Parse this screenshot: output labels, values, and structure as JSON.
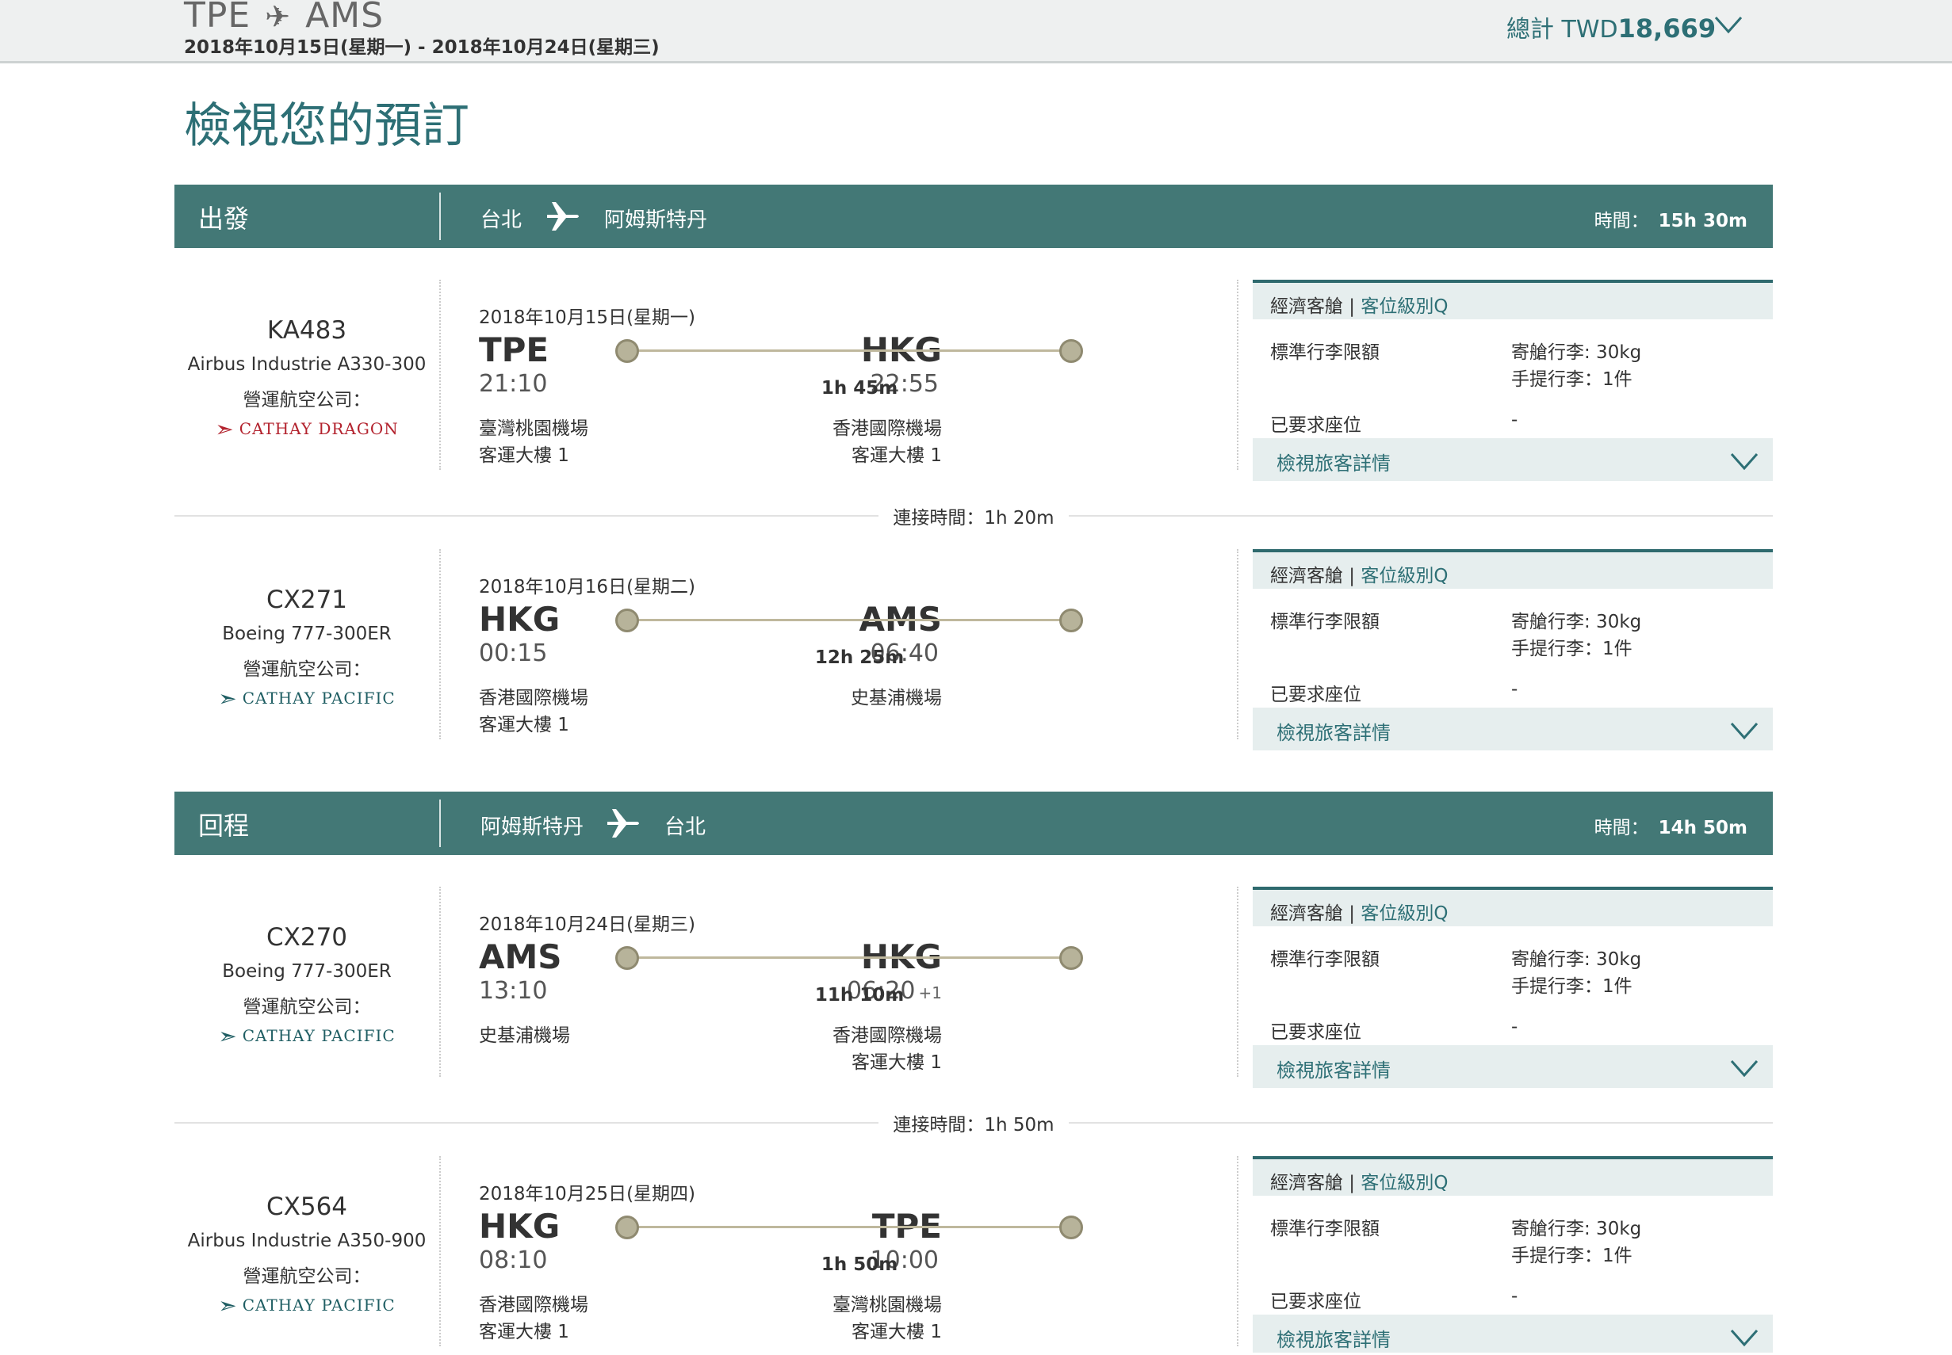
{
  "topbar": {
    "origin": "TPE",
    "destination": "AMS",
    "dates": "2018年10月15日(星期一) - 2018年10月24日(星期三)",
    "total_label": "總計 TWD",
    "total_amount": "18,669"
  },
  "page_title": "檢視您的預訂",
  "sections": [
    {
      "label": "出發",
      "from": "台北",
      "to": "阿姆斯特丹",
      "duration_label": "時間：",
      "duration": "15h 30m",
      "flights": [
        {
          "number": "KA483",
          "aircraft": "Airbus Industrie A330-300",
          "operator_label": "營運航空公司：",
          "airline": "CATHAY DRAGON",
          "date": "2018年10月15日(星期一)",
          "dep_code": "TPE",
          "dep_time": "21:10",
          "dep_airport": "臺灣桃園機場",
          "dep_terminal": "客運大樓 1",
          "arr_code": "HKG",
          "arr_time": "22:55",
          "arr_plus": "",
          "arr_airport": "香港國際機場",
          "arr_terminal": "客運大樓 1",
          "duration": "1h 45m",
          "cabin": "經濟客艙 |",
          "fare_class": "客位級別Q",
          "baggage_label": "標準行李限額",
          "checked": "寄艙行李: 30kg",
          "carry_on": "手提行李：1件",
          "seat_label": "已要求座位",
          "seat_value": "-",
          "view_label": "檢視旅客詳情"
        },
        {
          "number": "CX271",
          "aircraft": "Boeing 777-300ER",
          "operator_label": "營運航空公司：",
          "airline": "CATHAY PACIFIC",
          "date": "2018年10月16日(星期二)",
          "dep_code": "HKG",
          "dep_time": "00:15",
          "dep_airport": "香港國際機場",
          "dep_terminal": "客運大樓 1",
          "arr_code": "AMS",
          "arr_time": "06:40",
          "arr_plus": "",
          "arr_airport": "史基浦機場",
          "arr_terminal": "",
          "duration": "12h 25m",
          "cabin": "經濟客艙 |",
          "fare_class": "客位級別Q",
          "baggage_label": "標準行李限額",
          "checked": "寄艙行李: 30kg",
          "carry_on": "手提行李：1件",
          "seat_label": "已要求座位",
          "seat_value": "-",
          "view_label": "檢視旅客詳情"
        }
      ],
      "connection": "連接時間：1h 20m"
    },
    {
      "label": "回程",
      "from": "阿姆斯特丹",
      "to": "台北",
      "duration_label": "時間：",
      "duration": "14h 50m",
      "flights": [
        {
          "number": "CX270",
          "aircraft": "Boeing 777-300ER",
          "operator_label": "營運航空公司：",
          "airline": "CATHAY PACIFIC",
          "date": "2018年10月24日(星期三)",
          "dep_code": "AMS",
          "dep_time": "13:10",
          "dep_airport": "史基浦機場",
          "dep_terminal": "",
          "arr_code": "HKG",
          "arr_time": "06:20",
          "arr_plus": "+1",
          "arr_airport": "香港國際機場",
          "arr_terminal": "客運大樓 1",
          "duration": "11h 10m",
          "cabin": "經濟客艙 |",
          "fare_class": "客位級別Q",
          "baggage_label": "標準行李限額",
          "checked": "寄艙行李: 30kg",
          "carry_on": "手提行李：1件",
          "seat_label": "已要求座位",
          "seat_value": "-",
          "view_label": "檢視旅客詳情"
        },
        {
          "number": "CX564",
          "aircraft": "Airbus Industrie A350-900",
          "operator_label": "營運航空公司：",
          "airline": "CATHAY PACIFIC",
          "date": "2018年10月25日(星期四)",
          "dep_code": "HKG",
          "dep_time": "08:10",
          "dep_airport": "香港國際機場",
          "dep_terminal": "客運大樓 1",
          "arr_code": "TPE",
          "arr_time": "10:00",
          "arr_plus": "",
          "arr_airport": "臺灣桃園機場",
          "arr_terminal": "客運大樓 1",
          "duration": "1h 50m",
          "cabin": "經濟客艙 |",
          "fare_class": "客位級別Q",
          "baggage_label": "標準行李限額",
          "checked": "寄艙行李: 30kg",
          "carry_on": "手提行李：1件",
          "seat_label": "已要求座位",
          "seat_value": "-",
          "view_label": "檢視旅客詳情"
        }
      ],
      "connection": "連接時間：1h 50m"
    }
  ],
  "colors": {
    "accent": "#437876",
    "link": "#2d6f75",
    "dragon": "#b3232e",
    "pacific": "#1f5e63"
  },
  "icons": {
    "plane": "plane-icon",
    "chevron": "chevron-down-icon",
    "airline": "airline-swoosh-icon"
  }
}
